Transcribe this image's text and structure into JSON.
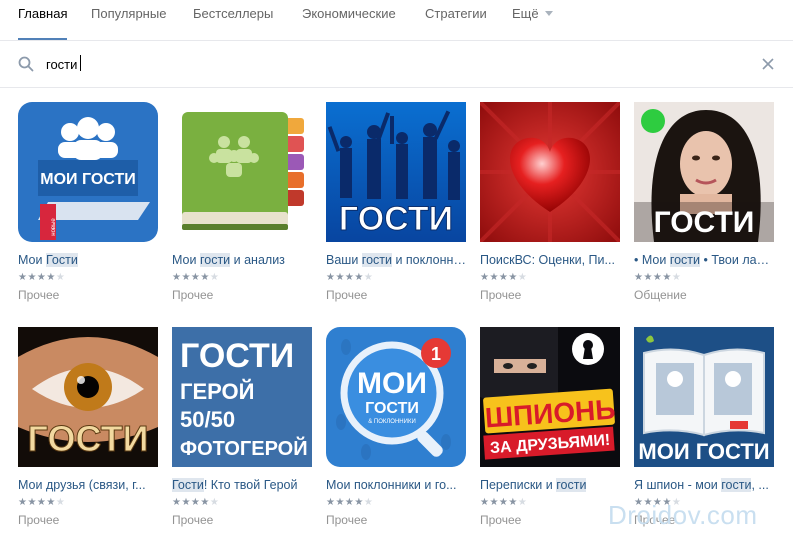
{
  "tabs": [
    {
      "label": "Главная",
      "active": true
    },
    {
      "label": "Популярные"
    },
    {
      "label": "Бестселлеры"
    },
    {
      "label": "Экономические"
    },
    {
      "label": "Стратегии"
    },
    {
      "label": "Ещё"
    }
  ],
  "search": {
    "value": "гости"
  },
  "apps": [
    {
      "title_before": "Мои ",
      "title_match": "Гости",
      "title_after": "",
      "category": "Прочее",
      "rating": 4,
      "icon": "moi-gosti-people-icon",
      "thumb_text": "МОИ ГОСТИ",
      "badge": "новые"
    },
    {
      "title_before": "Мои ",
      "title_match": "гости",
      "title_after": " и анализ",
      "category": "Прочее",
      "rating": 4,
      "icon": "green-book-icon"
    },
    {
      "title_before": "Ваши ",
      "title_match": "гости",
      "title_after": " и поклонники",
      "category": "Прочее",
      "rating": 4,
      "icon": "party-crowd-icon",
      "thumb_text": "ГОСТИ"
    },
    {
      "title_before": "ПоискВС: Оценки, Пи...",
      "title_match": "",
      "title_after": "",
      "category": "Прочее",
      "rating": 4,
      "icon": "red-heart-icon"
    },
    {
      "title_before": "• Мои ",
      "title_match": "гости",
      "title_after": " • Твои лайки",
      "category": "Общение",
      "rating": 4,
      "icon": "girl-portrait-icon",
      "thumb_text": "ГОСТИ"
    },
    {
      "title_before": "Мои друзья (связи, г...",
      "title_match": "",
      "title_after": "",
      "category": "Прочее",
      "rating": 4,
      "icon": "eye-closeup-icon",
      "thumb_text": "ГОСТИ"
    },
    {
      "title_before": "",
      "title_match": "Гости",
      "title_after": "! Кто твой Герой",
      "category": "Прочее",
      "rating": 4,
      "icon": "blue-text-tile-icon",
      "thumb_lines": [
        "ГОСТИ",
        "ГЕРОЙ",
        "50/50",
        "ФОТОГЕРОЙ"
      ]
    },
    {
      "title_before": "Мои поклонники и го...",
      "title_match": "",
      "title_after": "",
      "category": "Прочее",
      "rating": 4,
      "icon": "magnifier-badge-icon",
      "thumb_lines": [
        "МОИ",
        "ГОСТИ",
        "& ПОКЛОННИКИ"
      ],
      "badge": "1"
    },
    {
      "title_before": "Переписки и ",
      "title_match": "гости",
      "title_after": "",
      "category": "Прочее",
      "rating": 4,
      "icon": "spy-keyhole-icon",
      "thumb_lines": [
        "ШПИОНЬ",
        "ЗА ДРУЗЬЯМИ!"
      ]
    },
    {
      "title_before": "Я шпион - мои ",
      "title_match": "гости",
      "title_after": ", ...",
      "category": "Прочее",
      "rating": 4,
      "icon": "open-photo-album-icon",
      "thumb_text": "МОИ ГОСТИ"
    }
  ],
  "watermark": "Droidov.com"
}
